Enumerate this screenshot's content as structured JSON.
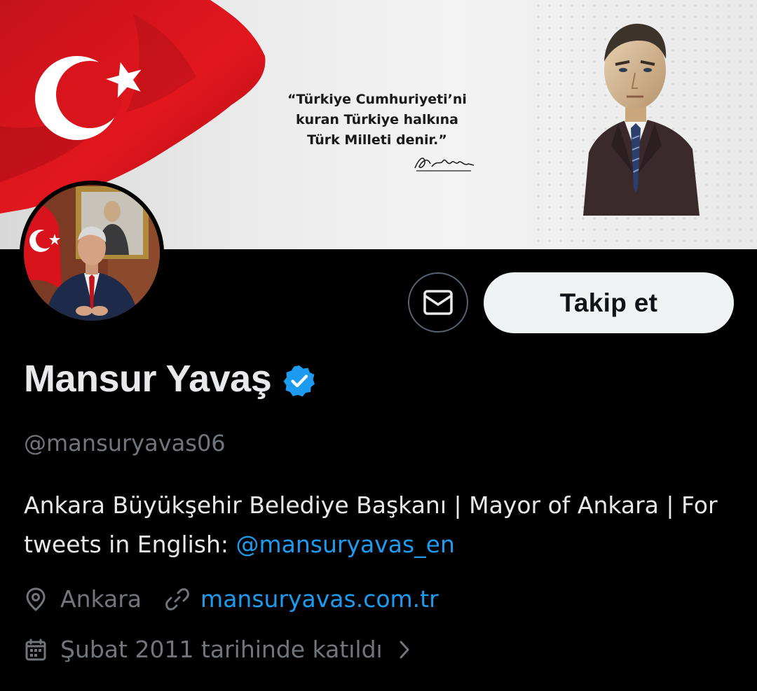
{
  "banner": {
    "quote_lines": [
      "“Türkiye Cumhuriyeti’ni",
      "kuran Türkiye halkına",
      "Türk Milleti denir.”"
    ]
  },
  "actions": {
    "message_icon": "envelope-icon",
    "follow_label": "Takip et"
  },
  "profile": {
    "name": "Mansur Yavaş",
    "verified_icon": "verified-badge-icon",
    "handle": "@mansuryavas06",
    "bio_text": "Ankara Büyükşehir Belediye Başkanı | Mayor of Ankara | For tweets in English: ",
    "bio_mention": "@mansuryavas_en",
    "location": "Ankara",
    "website": "mansuryavas.com.tr",
    "joined": "Şubat 2011 tarihinde katıldı"
  },
  "colors": {
    "background": "#000000",
    "text": "#e7e9ea",
    "muted": "#71767b",
    "link": "#1d9bf0",
    "follow_bg": "#eff3f4"
  }
}
